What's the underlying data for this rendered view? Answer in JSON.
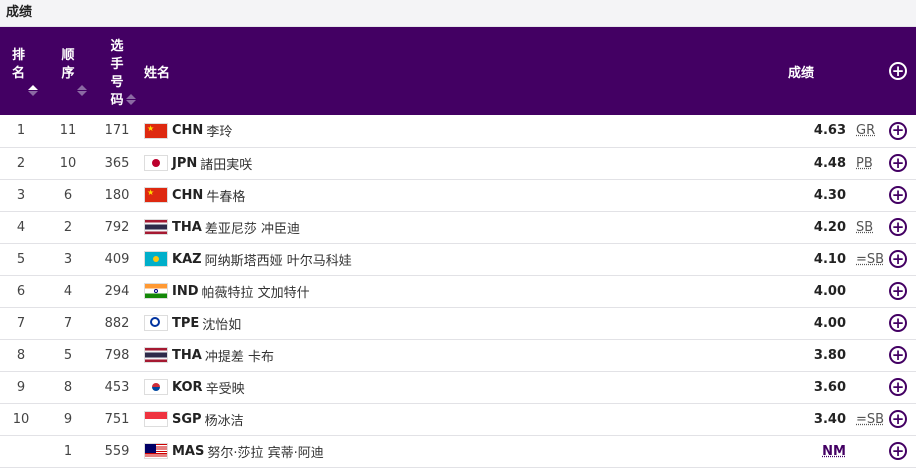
{
  "section_title": "成绩",
  "header": {
    "rank": "排名",
    "order": "顺序",
    "bib": "选手号码",
    "name": "姓名",
    "result": "成绩"
  },
  "colors": {
    "header_bg": "#430063",
    "accent": "#430063"
  },
  "rows": [
    {
      "rank": "1",
      "order": "11",
      "bib": "171",
      "country": "CHN",
      "name": "李玲",
      "result": "4.63",
      "note": "GR"
    },
    {
      "rank": "2",
      "order": "10",
      "bib": "365",
      "country": "JPN",
      "name": "諸田実咲",
      "result": "4.48",
      "note": "PB"
    },
    {
      "rank": "3",
      "order": "6",
      "bib": "180",
      "country": "CHN",
      "name": "牛春格",
      "result": "4.30",
      "note": ""
    },
    {
      "rank": "4",
      "order": "2",
      "bib": "792",
      "country": "THA",
      "name": "差亚尼莎 冲臣迪",
      "result": "4.20",
      "note": "SB"
    },
    {
      "rank": "5",
      "order": "3",
      "bib": "409",
      "country": "KAZ",
      "name": "阿纳斯塔西娅 叶尔马科娃",
      "result": "4.10",
      "note": "=SB"
    },
    {
      "rank": "6",
      "order": "4",
      "bib": "294",
      "country": "IND",
      "name": "帕薇特拉 文加特什",
      "result": "4.00",
      "note": ""
    },
    {
      "rank": "7",
      "order": "7",
      "bib": "882",
      "country": "TPE",
      "name": "沈怡如",
      "result": "4.00",
      "note": ""
    },
    {
      "rank": "8",
      "order": "5",
      "bib": "798",
      "country": "THA",
      "name": "冲提差 卡布",
      "result": "3.80",
      "note": ""
    },
    {
      "rank": "9",
      "order": "8",
      "bib": "453",
      "country": "KOR",
      "name": "辛受映",
      "result": "3.60",
      "note": ""
    },
    {
      "rank": "10",
      "order": "9",
      "bib": "751",
      "country": "SGP",
      "name": "杨冰洁",
      "result": "3.40",
      "note": "=SB"
    },
    {
      "rank": "",
      "order": "1",
      "bib": "559",
      "country": "MAS",
      "name": "努尔·莎拉 宾蒂·阿迪",
      "result": "NM",
      "note": ""
    }
  ]
}
